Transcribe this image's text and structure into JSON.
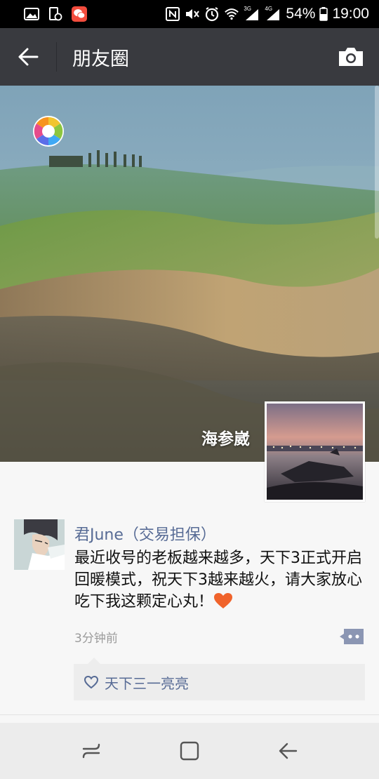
{
  "status_bar": {
    "network_3g": "3G",
    "network_4g": "4G",
    "battery": "54%",
    "time": "19:00"
  },
  "header": {
    "title": "朋友圈"
  },
  "cover": {
    "user_name": "海参崴"
  },
  "post": {
    "author": "君June（交易担保）",
    "text": "最近收号的老板越来越多，天下3正式开启回暖模式，祝天下3越来越火，请大家放心吃下我这颗定心丸！",
    "time": "3分钟前",
    "likes": [
      "天下三一亮亮"
    ]
  },
  "colors": {
    "title_bar": "#393a3f",
    "link_blue": "#576b95",
    "heart_orange": "#f0632b"
  }
}
